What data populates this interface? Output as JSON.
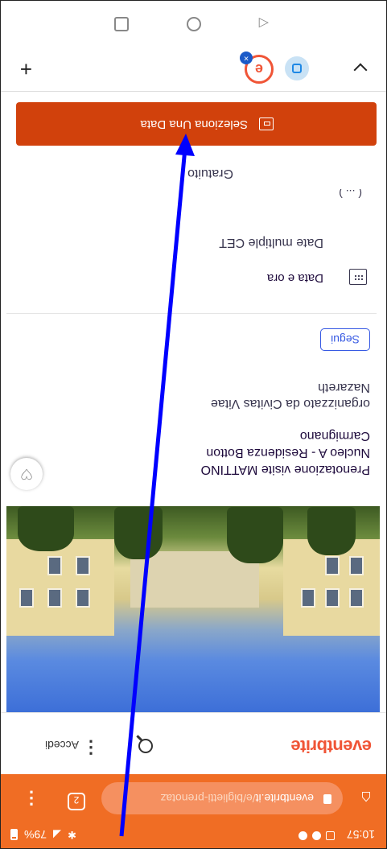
{
  "status_bar": {
    "time": "10:57",
    "battery": "79%"
  },
  "browser": {
    "url_domain": "eventbrite.it",
    "url_path": "/e/biglietti-prenotaz",
    "tab_count": "2",
    "active_tab_letter": "e",
    "tab_close": "×",
    "add_tab": "+"
  },
  "site": {
    "logo": "eventbrite",
    "login": "Accedi"
  },
  "event": {
    "title_line1": "Prenotazione visite MATTINO",
    "title_line2": "Nucleo A - Residenza Botton",
    "title_line3": "Carmignano",
    "organizer_line1": "organizzato da Civitas Vitae",
    "organizer_line2": "Nazareth",
    "follow": "Segui",
    "datetime_heading": "Data e ora",
    "datetime_value": "Date multiple CET",
    "datetime_partial": "( ... )",
    "price": "Gratuito",
    "select_button": "Seleziona Una Data"
  },
  "colors": {
    "brand_orange": "#f05537",
    "browser_orange": "#f06d24",
    "cta": "#d1410c",
    "follow_blue": "#3659e3",
    "arrow_blue": "#0000ff"
  }
}
